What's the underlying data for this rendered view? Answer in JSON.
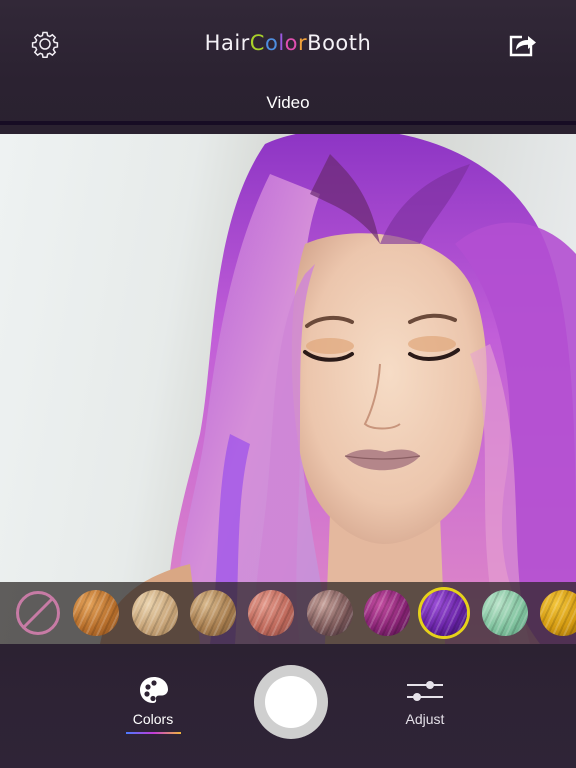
{
  "header": {
    "title_parts": [
      {
        "text": "Hair",
        "color": "#f4f1f6"
      },
      {
        "text": "C",
        "color": "#a8d12a"
      },
      {
        "text": "o",
        "color": "#4e8fe0"
      },
      {
        "text": "l",
        "color": "#9b5ae0"
      },
      {
        "text": "o",
        "color": "#e04fb0"
      },
      {
        "text": "r",
        "color": "#f0a03a"
      },
      {
        "text": "Booth",
        "color": "#f4f1f6"
      }
    ],
    "mode_label": "Video",
    "settings_icon": "gear-icon",
    "share_icon": "share-icon"
  },
  "photo": {
    "subject": "woman with purple-pink hair, eyes closed"
  },
  "swatches": {
    "none_color": "#c77ba5",
    "items": [
      {
        "name": "copper",
        "colors": [
          "#e3a25a",
          "#b9702c",
          "#8a4e1c"
        ]
      },
      {
        "name": "light-blonde",
        "colors": [
          "#ead3ae",
          "#c9a67a",
          "#9d7c52"
        ]
      },
      {
        "name": "dark-blonde",
        "colors": [
          "#d8b88c",
          "#a97f50",
          "#74532f"
        ]
      },
      {
        "name": "rose",
        "colors": [
          "#e39a8c",
          "#c06a5c",
          "#8e4a42"
        ]
      },
      {
        "name": "mauve-brown",
        "colors": [
          "#c8a39c",
          "#7e5a5a",
          "#3f2b36"
        ]
      },
      {
        "name": "magenta",
        "colors": [
          "#c24ea0",
          "#8a2476",
          "#4a1044"
        ]
      },
      {
        "name": "violet",
        "colors": [
          "#9a4ed6",
          "#6a24a8",
          "#2e0c5e"
        ]
      },
      {
        "name": "mint",
        "colors": [
          "#b8e2c8",
          "#82c4a0",
          "#5a9c7c"
        ]
      },
      {
        "name": "gold",
        "colors": [
          "#f2c43a",
          "#d49a10",
          "#8e6406"
        ]
      }
    ],
    "selected_index": 6,
    "selected_ring_color": "#e6d21a"
  },
  "bottom_bar": {
    "colors_tab": {
      "label": "Colors",
      "icon": "palette-icon",
      "active": true
    },
    "adjust_tab": {
      "label": "Adjust",
      "icon": "sliders-icon",
      "active": false
    },
    "shutter": "capture-button"
  }
}
